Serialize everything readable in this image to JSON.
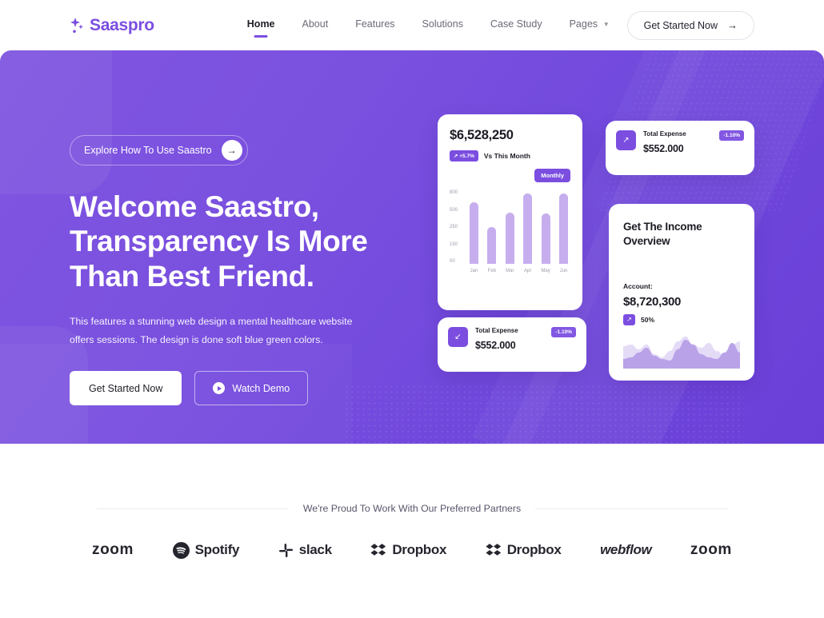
{
  "brand": {
    "name": "Saaspro",
    "icon": "sparkle-icon",
    "color": "#7b4ee0"
  },
  "nav": {
    "items": [
      {
        "label": "Home",
        "active": true
      },
      {
        "label": "About",
        "active": false
      },
      {
        "label": "Features",
        "active": false
      },
      {
        "label": "Solutions",
        "active": false
      },
      {
        "label": "Case Study",
        "active": false
      },
      {
        "label": "Pages",
        "active": false,
        "caret": "⌄"
      }
    ],
    "cta": {
      "label": "Get Started Now",
      "arrow": "→"
    }
  },
  "hero": {
    "pill": {
      "label": "Explore How To Use Saastro",
      "arrow": "→"
    },
    "title": "Welcome Saastro, Transparency Is More Than Best Friend.",
    "title_lines": [
      "Welcome Saastro,",
      "Transparency Is More",
      "Than Best Friend."
    ],
    "subtitle": "This features a stunning web design a mental healthcare website offers sessions. The design is done soft blue green colors.",
    "primary_button": "Get Started Now",
    "secondary_button": "Watch Demo"
  },
  "dashboard": {
    "chart_card": {
      "amount": "$6,528,250",
      "change_badge": "↗ +5.7%",
      "change_label": "Vs This Month",
      "period_chip": "Monthly"
    },
    "expense_card_top": {
      "icon": "arrow-up-right-icon",
      "icon_glyph": "↗",
      "label": "Total Expense",
      "value": "$552.000",
      "badge": "-1.10%"
    },
    "expense_card_bottom": {
      "icon": "arrow-down-left-icon",
      "icon_glyph": "↙",
      "label": "Total Expense",
      "value": "$552.000",
      "badge": "-1.10%"
    },
    "income_card": {
      "title": "Get The Income Overview",
      "account_label": "Account:",
      "amount": "$8,720,300",
      "percent": "50%",
      "percent_icon_glyph": "↗"
    }
  },
  "chart_data": {
    "type": "bar",
    "title": "$6,528,250",
    "categories": [
      "Jan",
      "Feb",
      "Mar",
      "Apr",
      "May",
      "Jun"
    ],
    "values": [
      740,
      440,
      610,
      840,
      600,
      840
    ],
    "ytick_labels": [
      "800",
      "500",
      "250",
      "150",
      "00"
    ],
    "ytick_values": [
      800,
      500,
      250,
      150,
      0
    ],
    "ylim": [
      0,
      880
    ],
    "xlabel": "",
    "ylabel": "",
    "grid": false,
    "legend": false,
    "bar_color": "#c6aeee",
    "annotations": [
      "↗ +5.7% Vs This Month",
      "Monthly"
    ]
  },
  "income_spark": {
    "type": "area",
    "series": [
      {
        "name": "back",
        "color": "#e4dbf7",
        "values": [
          28,
          30,
          24,
          30,
          18,
          14,
          22,
          34,
          40,
          30,
          26,
          32,
          22,
          16,
          30,
          34
        ]
      },
      {
        "name": "front",
        "color": "#b9a2e8",
        "values": [
          12,
          14,
          20,
          26,
          16,
          12,
          10,
          24,
          36,
          30,
          18,
          14,
          12,
          20,
          32,
          20
        ]
      }
    ],
    "ylim": [
      0,
      44
    ]
  },
  "partners": {
    "title": "We're Proud To Work With Our Preferred Partners",
    "logos": [
      {
        "name": "zoom",
        "label": "zoom",
        "mark": "none"
      },
      {
        "name": "spotify",
        "label": "Spotify",
        "mark": "spotify-icon"
      },
      {
        "name": "slack",
        "label": "slack",
        "mark": "slack-icon"
      },
      {
        "name": "dropbox",
        "label": "Dropbox",
        "mark": "dropbox-icon"
      },
      {
        "name": "dropbox-2",
        "label": "Dropbox",
        "mark": "dropbox-icon"
      },
      {
        "name": "webflow",
        "label": "webflow",
        "mark": "none"
      },
      {
        "name": "zoom-2",
        "label": "zoom",
        "mark": "none"
      }
    ]
  }
}
